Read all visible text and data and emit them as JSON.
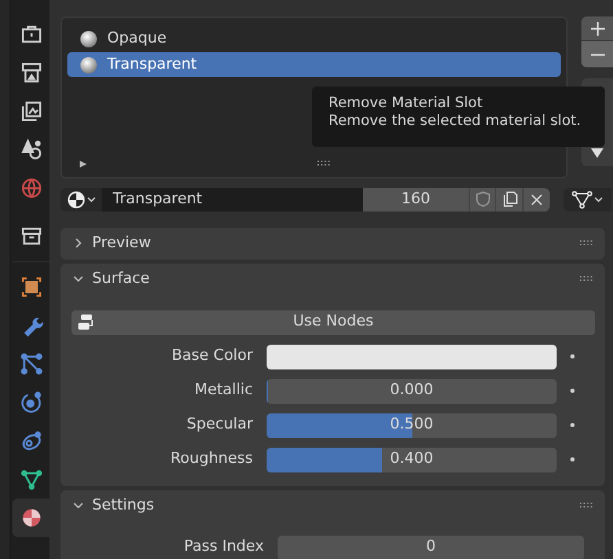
{
  "sidebar": {
    "tabs": [
      {
        "selected": false
      },
      {
        "selected": false
      },
      {
        "selected": false
      },
      {
        "selected": false
      },
      {
        "selected": false
      },
      {
        "selected": false
      },
      {
        "selected": false
      },
      {
        "selected": false
      },
      {
        "selected": false
      },
      {
        "selected": false
      },
      {
        "selected": false
      },
      {
        "selected": false
      },
      {
        "selected": true
      }
    ]
  },
  "material_slots": [
    {
      "name": "Opaque",
      "selected": false
    },
    {
      "name": "Transparent",
      "selected": true
    }
  ],
  "tooltip": {
    "title": "Remove Material Slot",
    "description": "Remove the selected material slot."
  },
  "material": {
    "name": "Transparent",
    "users": "160"
  },
  "panels": [
    {
      "title": "Preview",
      "expanded": false
    },
    {
      "title": "Surface",
      "expanded": true,
      "button": "Use Nodes",
      "properties": [
        {
          "label": "Base Color",
          "kind": "color",
          "color": "#e6e6e6"
        },
        {
          "label": "Metallic",
          "kind": "slider",
          "value": "0.000",
          "level": 0
        },
        {
          "label": "Specular",
          "kind": "slider",
          "value": "0.500",
          "level": 0.5
        },
        {
          "label": "Roughness",
          "kind": "slider",
          "value": "0.400",
          "level": 0.4
        }
      ]
    },
    {
      "title": "Settings",
      "expanded": true,
      "fields": [
        {
          "label": "Pass Index",
          "value": "0"
        }
      ]
    }
  ]
}
